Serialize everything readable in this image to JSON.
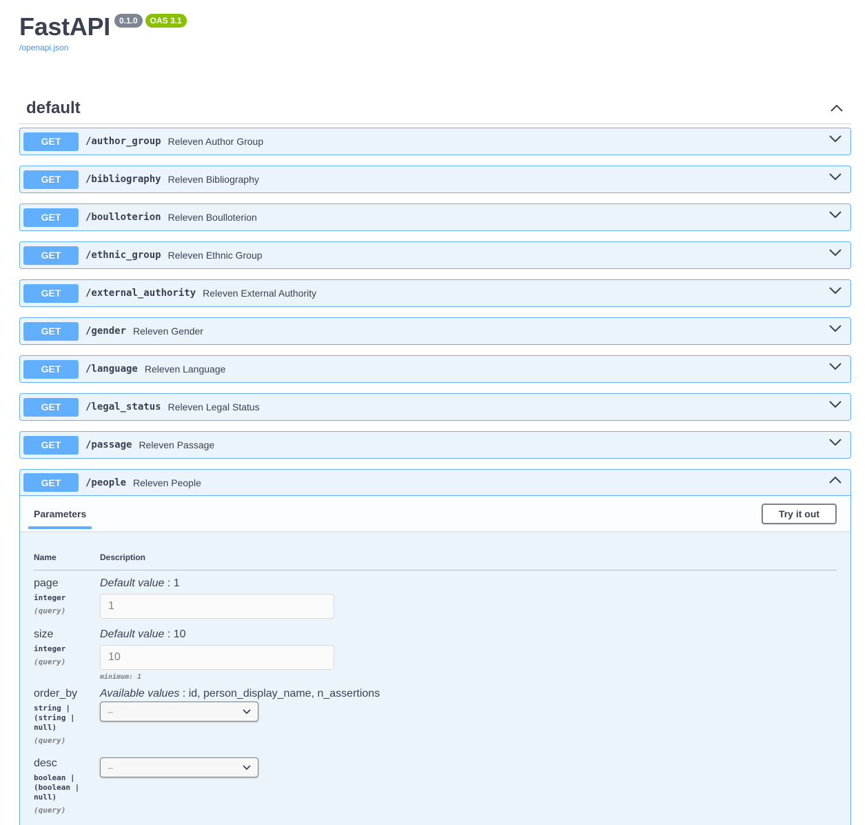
{
  "header": {
    "title": "FastAPI",
    "version_badge": "0.1.0",
    "oas_badge": "OAS 3.1",
    "spec_link": "/openapi.json"
  },
  "tag": {
    "name": "default"
  },
  "operations": [
    {
      "method": "GET",
      "path": "/author_group",
      "summary": "Releven Author Group"
    },
    {
      "method": "GET",
      "path": "/bibliography",
      "summary": "Releven Bibliography"
    },
    {
      "method": "GET",
      "path": "/boulloterion",
      "summary": "Releven Boulloterion"
    },
    {
      "method": "GET",
      "path": "/ethnic_group",
      "summary": "Releven Ethnic Group"
    },
    {
      "method": "GET",
      "path": "/external_authority",
      "summary": "Releven External Authority"
    },
    {
      "method": "GET",
      "path": "/gender",
      "summary": "Releven Gender"
    },
    {
      "method": "GET",
      "path": "/language",
      "summary": "Releven Language"
    },
    {
      "method": "GET",
      "path": "/legal_status",
      "summary": "Releven Legal Status"
    },
    {
      "method": "GET",
      "path": "/passage",
      "summary": "Releven Passage"
    },
    {
      "method": "GET",
      "path": "/people",
      "summary": "Releven People"
    }
  ],
  "expanded": {
    "params_tab": "Parameters",
    "try_button": "Try it out",
    "col_name": "Name",
    "col_description": "Description",
    "params": [
      {
        "name": "page",
        "type": "integer",
        "in": "(query)",
        "desc_label": "Default value",
        "desc_value": ": 1",
        "input_placeholder": "1"
      },
      {
        "name": "size",
        "type": "integer",
        "in": "(query)",
        "desc_label": "Default value",
        "desc_value": ": 10",
        "input_placeholder": "10",
        "minimum": "minimum: 1"
      },
      {
        "name": "order_by",
        "type_lines": [
          "string |",
          "(string |",
          "null)"
        ],
        "in": "(query)",
        "desc_label": "Available values",
        "desc_value": ": id, person_display_name, n_assertions",
        "select_value": "--"
      },
      {
        "name": "desc",
        "type_lines": [
          "boolean |",
          "(boolean |",
          "null)"
        ],
        "in": "(query)",
        "select_value": "--"
      }
    ]
  },
  "colors": {
    "get_method": "#61affe",
    "op_background": "#ebf3fb",
    "oas_badge": "#89bf04",
    "version_badge": "#7d8492",
    "link": "#4990e2"
  }
}
